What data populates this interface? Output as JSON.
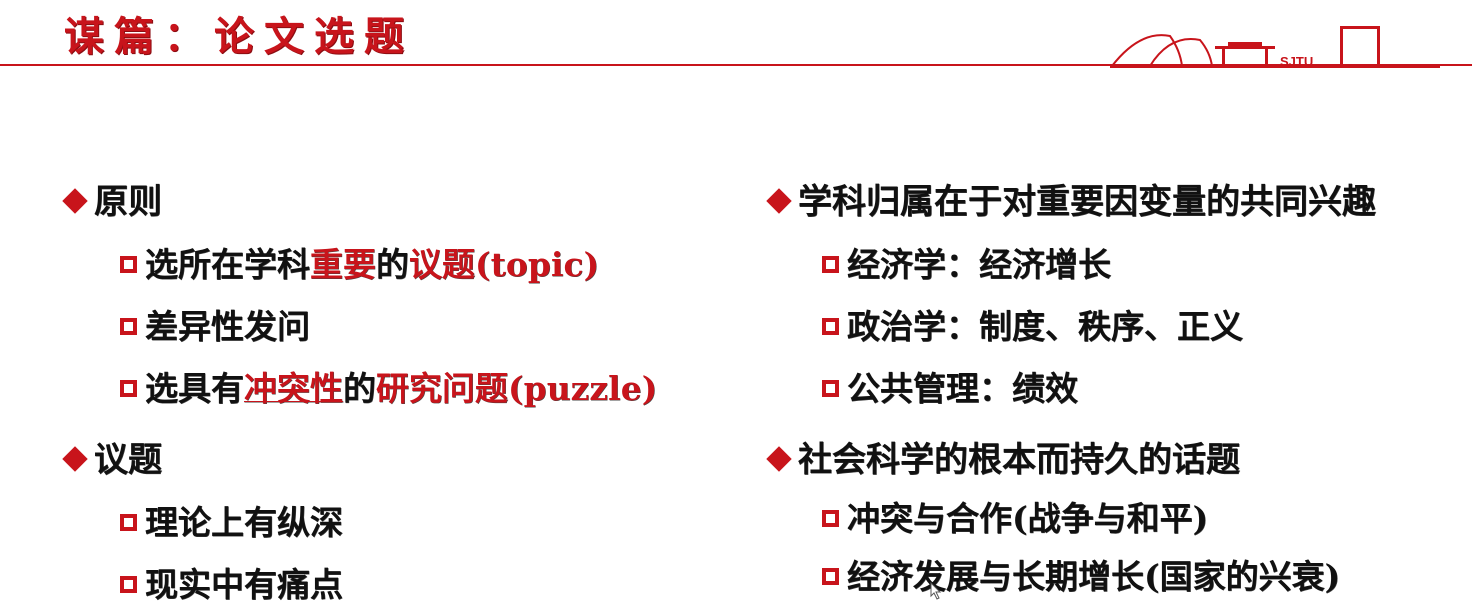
{
  "slide": {
    "title": "谋篇：论文选题",
    "logo_text": "SJTU"
  },
  "left": {
    "principle": {
      "heading": "原则",
      "items": [
        {
          "parts": [
            {
              "t": "选所在学科",
              "s": "n"
            },
            {
              "t": "重要",
              "s": "r"
            },
            {
              "t": "的",
              "s": "n"
            },
            {
              "t": "议题(topic)",
              "s": "r"
            }
          ]
        },
        {
          "parts": [
            {
              "t": "差异性发问",
              "s": "n"
            }
          ]
        },
        {
          "parts": [
            {
              "t": "选具有",
              "s": "n"
            },
            {
              "t": "冲突性",
              "s": "ru"
            },
            {
              "t": "的",
              "s": "n"
            },
            {
              "t": "研究问题(puzzle)",
              "s": "r"
            }
          ]
        }
      ]
    },
    "topic": {
      "heading": "议题",
      "items": [
        "理论上有纵深",
        "现实中有痛点"
      ]
    }
  },
  "right": {
    "discipline": {
      "heading": "学科归属在于对重要因变量的共同兴趣",
      "items": [
        "经济学：经济增长",
        "政治学：制度、秩序、正义",
        "公共管理：绩效"
      ]
    },
    "social": {
      "heading": "社会科学的根本而持久的话题",
      "items": [
        "冲突与合作(战争与和平)",
        "经济发展与长期增长(国家的兴衰)"
      ]
    }
  },
  "colors": {
    "accent": "#c8141b",
    "text": "#111111"
  }
}
